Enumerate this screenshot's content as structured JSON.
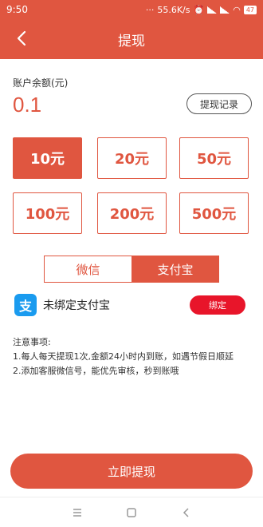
{
  "status_bar": {
    "time": "9:50",
    "speed": "55.6K/s",
    "battery": "47"
  },
  "header": {
    "title": "提现"
  },
  "balance": {
    "label": "账户余额(元)",
    "value": "0.1",
    "record_button": "提现记录"
  },
  "amounts": [
    {
      "label": "10元",
      "selected": true
    },
    {
      "label": "20元",
      "selected": false
    },
    {
      "label": "50元",
      "selected": false
    },
    {
      "label": "100元",
      "selected": false
    },
    {
      "label": "200元",
      "selected": false
    },
    {
      "label": "500元",
      "selected": false
    }
  ],
  "payment_tabs": {
    "wechat": "微信",
    "alipay": "支付宝",
    "active": "alipay"
  },
  "alipay_binding": {
    "icon_char": "支",
    "status_text": "未绑定支付宝",
    "bind_button": "绑定"
  },
  "notes": {
    "title": "注意事项:",
    "items": [
      "1.每人每天提现1次,金额24小时内到账，如遇节假日顺延",
      "2.添加客服微信号，能优先审核，秒到账哦"
    ]
  },
  "submit_button": "立即提现",
  "colors": {
    "accent": "#e05640",
    "bind_red": "#e8152a",
    "alipay_blue": "#1a9bef"
  }
}
